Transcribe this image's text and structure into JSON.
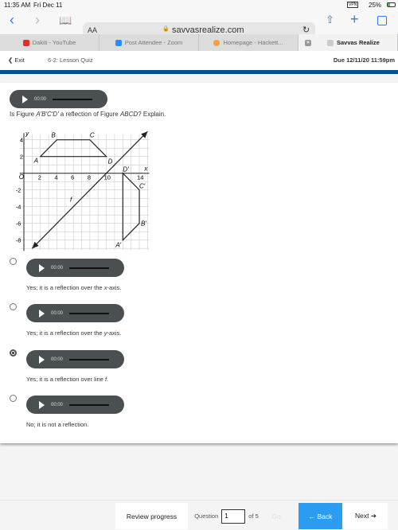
{
  "status": {
    "time": "11:35 AM",
    "date": "Fri Dec 11",
    "vpn": "VPN",
    "battery": "25%"
  },
  "browser": {
    "text_size": "AA",
    "url": "savvasrealize.com",
    "tabs": [
      {
        "label": "Dakiti - YouTube",
        "color": "#e52d27"
      },
      {
        "label": "Post Attendee - Zoom",
        "color": "#2d8cff"
      },
      {
        "label": "Homepage - Hackett...",
        "color": "#f0a040"
      },
      {
        "label": "Savvas Realize",
        "color": "#cccccc"
      }
    ]
  },
  "nav": {
    "exit": "Exit",
    "title": "6-2: Lesson Quiz",
    "due": "Due 12/11/20 11:59pm"
  },
  "question": {
    "audio_time": "00:00",
    "text_pre": "Is Figure ",
    "fig1": "A′B′C′D′",
    "text_mid": " a reflection of Figure ",
    "fig2": "ABCD",
    "text_post": "? Explain."
  },
  "figure": {
    "x_axis_label": "x",
    "y_axis_label": "y",
    "origin_label": "O",
    "line_label": "f",
    "x_ticks": [
      2,
      4,
      6,
      8,
      10,
      14
    ],
    "y_ticks": [
      4,
      2,
      -2,
      -4,
      -6,
      -8
    ],
    "ABCD": [
      {
        "label": "A",
        "x": 2,
        "y": 2
      },
      {
        "label": "B",
        "x": 4,
        "y": 4
      },
      {
        "label": "C",
        "x": 8,
        "y": 4
      },
      {
        "label": "D",
        "x": 10,
        "y": 2
      }
    ],
    "A'B'C'D'": [
      {
        "label": "A′",
        "x": 12,
        "y": -8
      },
      {
        "label": "B′",
        "x": 14,
        "y": -6
      },
      {
        "label": "C′",
        "x": 14,
        "y": -2
      },
      {
        "label": "D′",
        "x": 12,
        "y": 0
      }
    ],
    "line_f": {
      "slope": 1,
      "intercept": -10
    }
  },
  "options": [
    {
      "audio_time": "00:00",
      "text": "Yes; it is a reflection over the ",
      "var": "x",
      "tail": "-axis.",
      "selected": false
    },
    {
      "audio_time": "00:00",
      "text": "Yes; it is a reflection over the ",
      "var": "y",
      "tail": "-axis.",
      "selected": false
    },
    {
      "audio_time": "00:00",
      "text": "Yes; it is a reflection over line ",
      "var": "f",
      "tail": ".",
      "selected": true
    },
    {
      "audio_time": "00:00",
      "text": "No; it is not a reflection.",
      "var": "",
      "tail": "",
      "selected": false
    }
  ],
  "footer": {
    "review": "Review progress",
    "question_label": "Question",
    "question_value": "1",
    "of": "of 5",
    "go": "Go",
    "back": "← Back",
    "next": "Next ➔",
    "accent": "#2b9cf0"
  }
}
